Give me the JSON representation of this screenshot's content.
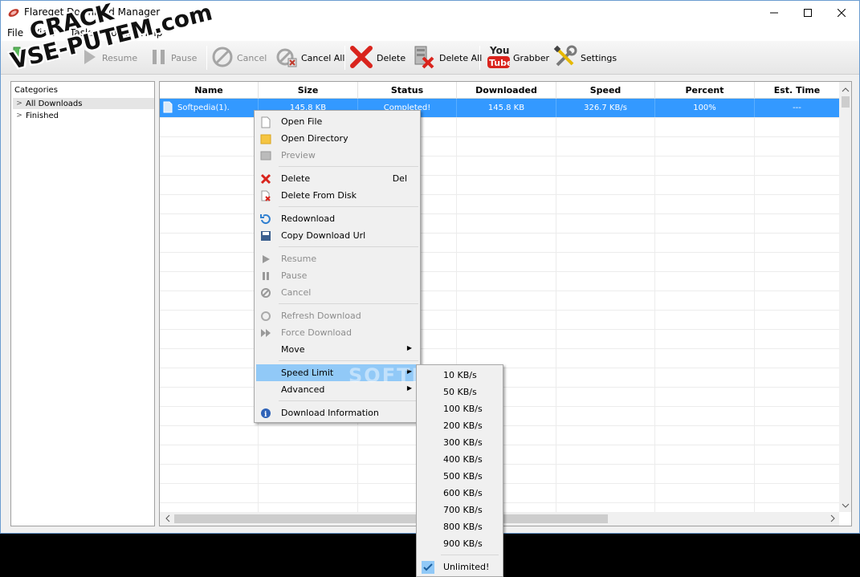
{
  "window": {
    "title": "Flareget Download Manager"
  },
  "menu": [
    "File",
    "View",
    "Tasks",
    "Tools",
    "Help"
  ],
  "toolbar": {
    "resume": "Resume",
    "pause": "Pause",
    "cancel": "Cancel",
    "cancel_all": "Cancel All",
    "delete": "Delete",
    "delete_all": "Delete All",
    "grabber": "Grabber",
    "settings": "Settings",
    "youtube_logo": "You Tube"
  },
  "sidebar": {
    "header": "Categories",
    "items": [
      "All Downloads",
      "Finished"
    ]
  },
  "table": {
    "columns": [
      "Name",
      "Size",
      "Status",
      "Downloaded",
      "Speed",
      "Percent",
      "Est. Time"
    ],
    "rows": [
      {
        "name": "Softpedia(1).",
        "size": "145.8 KB",
        "status": "Completed!",
        "downloaded": "145.8 KB",
        "speed": "326.7 KB/s",
        "percent": "100%",
        "est_time": "---"
      }
    ]
  },
  "context_menu": {
    "open_file": "Open File",
    "open_directory": "Open Directory",
    "preview": "Preview",
    "delete": "Delete",
    "delete_shortcut": "Del",
    "delete_from_disk": "Delete From Disk",
    "redownload": "Redownload",
    "copy_url": "Copy Download Url",
    "resume": "Resume",
    "pause": "Pause",
    "cancel": "Cancel",
    "refresh": "Refresh Download",
    "force": "Force Download",
    "move": "Move",
    "speed_limit": "Speed Limit",
    "advanced": "Advanced",
    "download_info": "Download Information"
  },
  "speed_submenu": [
    "10 KB/s",
    "50 KB/s",
    "100 KB/s",
    "200 KB/s",
    "300 KB/s",
    "400 KB/s",
    "500 KB/s",
    "600 KB/s",
    "700 KB/s",
    "800 KB/s",
    "900 KB/s",
    "Unlimited!"
  ],
  "watermark": {
    "line1": "CRACK",
    "line2": "VSE-PUTEM.com",
    "softpedia": "SOFTPEDIA"
  }
}
